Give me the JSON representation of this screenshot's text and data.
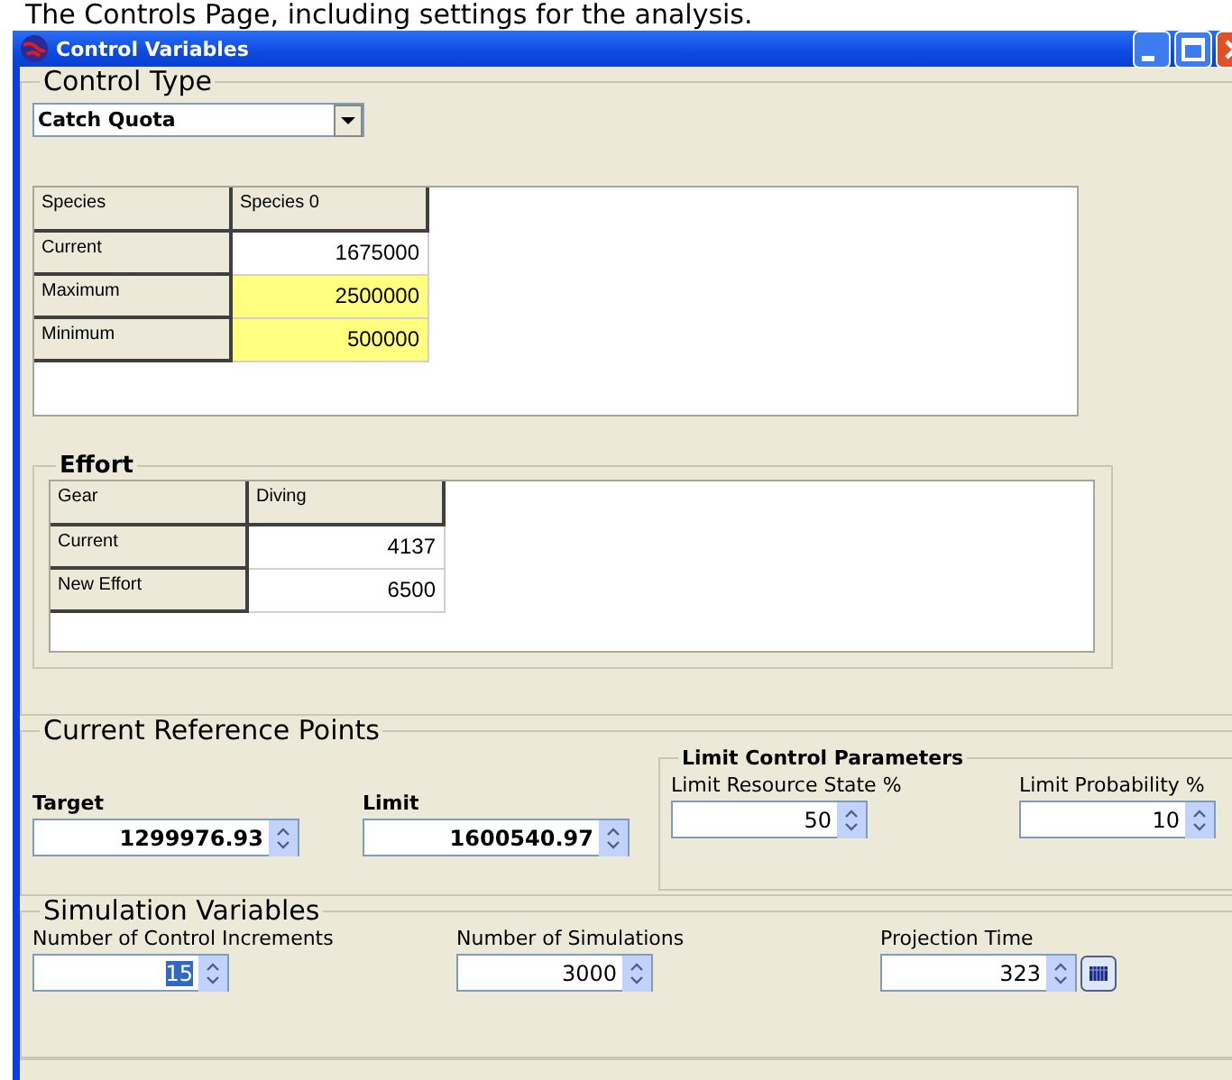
{
  "caption": "The Controls Page, including settings for the analysis.",
  "window": {
    "title": "Control Variables"
  },
  "control_type": {
    "legend": "Control Type",
    "dropdown": {
      "value": "Catch Quota"
    },
    "table": {
      "columns": [
        "Species",
        "Species 0"
      ],
      "rows": [
        {
          "label": "Current",
          "value": "1675000",
          "highlighted": false
        },
        {
          "label": "Maximum",
          "value": "2500000",
          "highlighted": true
        },
        {
          "label": "Minimum",
          "value": "500000",
          "highlighted": true
        }
      ]
    }
  },
  "effort": {
    "legend": "Effort",
    "table": {
      "columns": [
        "Gear",
        "Diving"
      ],
      "rows": [
        {
          "label": "Current",
          "value": "4137",
          "highlighted": false
        },
        {
          "label": "New Effort",
          "value": "6500",
          "highlighted": false
        }
      ]
    }
  },
  "reference_points": {
    "legend": "Current Reference Points",
    "fields": [
      {
        "label": "Target",
        "value": "1299976.93"
      },
      {
        "label": "Limit",
        "value": "1600540.97"
      }
    ],
    "limit_control": {
      "legend": "Limit Control Parameters",
      "fields": [
        {
          "label": "Limit Resource State %",
          "value": "50"
        },
        {
          "label": "Limit Probability %",
          "value": "10"
        }
      ]
    }
  },
  "simulation": {
    "legend": "Simulation Variables",
    "fields": [
      {
        "label": "Number of Control Increments",
        "value": "15",
        "selected": true,
        "picker_button": false
      },
      {
        "label": "Number of Simulations",
        "value": "3000",
        "selected": false,
        "picker_button": false
      },
      {
        "label": "Projection Time",
        "value": "323",
        "selected": false,
        "picker_button": true
      }
    ]
  }
}
